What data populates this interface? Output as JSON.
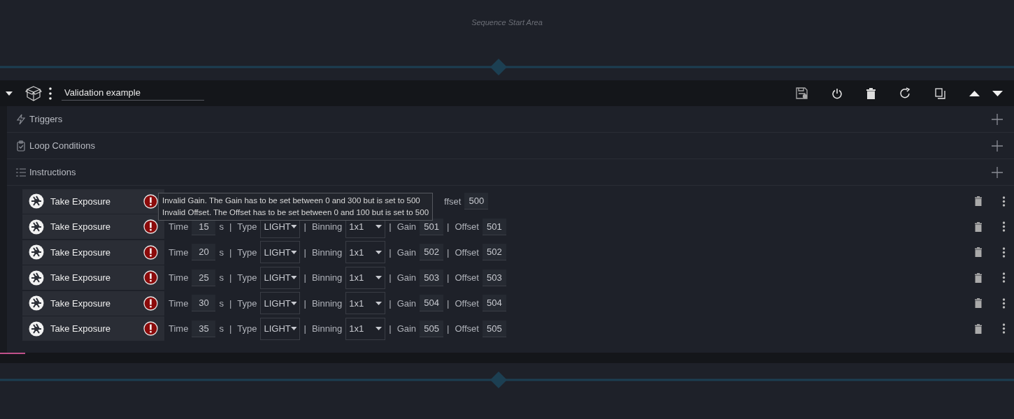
{
  "start_area": {
    "label": "Sequence Start Area"
  },
  "container": {
    "expanded": true,
    "name": "Validation example"
  },
  "sections": [
    {
      "kind": "triggers",
      "label": "Triggers"
    },
    {
      "kind": "conditions",
      "label": "Loop Conditions"
    },
    {
      "kind": "instructions",
      "label": "Instructions"
    }
  ],
  "tooltip": [
    "Invalid Gain. The Gain has to be set between 0 and 300 but is set to 500",
    "Invalid Offset. The Offset has to be set between 0 and 100 but is set to 500"
  ],
  "instructions": [
    {
      "name": "Take Exposure",
      "error": true,
      "params": [
        {
          "kind": "gap"
        },
        {
          "kind": "label",
          "text": "ffset"
        },
        {
          "kind": "field",
          "text": "500"
        }
      ]
    },
    {
      "name": "Take Exposure",
      "error": true,
      "params": [
        {
          "kind": "label",
          "text": "Time"
        },
        {
          "kind": "field",
          "text": "15"
        },
        {
          "kind": "label",
          "text": "s"
        },
        {
          "kind": "sep",
          "text": "|"
        },
        {
          "kind": "label",
          "text": "Type"
        },
        {
          "kind": "select",
          "text": "LIGHT"
        },
        {
          "kind": "sep",
          "text": "|"
        },
        {
          "kind": "label",
          "text": "Binning"
        },
        {
          "kind": "select",
          "text": "1x1"
        },
        {
          "kind": "sep",
          "text": "|"
        },
        {
          "kind": "label",
          "text": "Gain"
        },
        {
          "kind": "field",
          "text": "501"
        },
        {
          "kind": "sep",
          "text": "|"
        },
        {
          "kind": "label",
          "text": "Offset"
        },
        {
          "kind": "field",
          "text": "501"
        }
      ]
    },
    {
      "name": "Take Exposure",
      "error": true,
      "params": [
        {
          "kind": "label",
          "text": "Time"
        },
        {
          "kind": "field",
          "text": "20"
        },
        {
          "kind": "label",
          "text": "s"
        },
        {
          "kind": "sep",
          "text": "|"
        },
        {
          "kind": "label",
          "text": "Type"
        },
        {
          "kind": "select",
          "text": "LIGHT"
        },
        {
          "kind": "sep",
          "text": "|"
        },
        {
          "kind": "label",
          "text": "Binning"
        },
        {
          "kind": "select",
          "text": "1x1"
        },
        {
          "kind": "sep",
          "text": "|"
        },
        {
          "kind": "label",
          "text": "Gain"
        },
        {
          "kind": "field",
          "text": "502"
        },
        {
          "kind": "sep",
          "text": "|"
        },
        {
          "kind": "label",
          "text": "Offset"
        },
        {
          "kind": "field",
          "text": "502"
        }
      ]
    },
    {
      "name": "Take Exposure",
      "error": true,
      "params": [
        {
          "kind": "label",
          "text": "Time"
        },
        {
          "kind": "field",
          "text": "25"
        },
        {
          "kind": "label",
          "text": "s"
        },
        {
          "kind": "sep",
          "text": "|"
        },
        {
          "kind": "label",
          "text": "Type"
        },
        {
          "kind": "select",
          "text": "LIGHT"
        },
        {
          "kind": "sep",
          "text": "|"
        },
        {
          "kind": "label",
          "text": "Binning"
        },
        {
          "kind": "select",
          "text": "1x1"
        },
        {
          "kind": "sep",
          "text": "|"
        },
        {
          "kind": "label",
          "text": "Gain"
        },
        {
          "kind": "field",
          "text": "503"
        },
        {
          "kind": "sep",
          "text": "|"
        },
        {
          "kind": "label",
          "text": "Offset"
        },
        {
          "kind": "field",
          "text": "503"
        }
      ]
    },
    {
      "name": "Take Exposure",
      "error": true,
      "params": [
        {
          "kind": "label",
          "text": "Time"
        },
        {
          "kind": "field",
          "text": "30"
        },
        {
          "kind": "label",
          "text": "s"
        },
        {
          "kind": "sep",
          "text": "|"
        },
        {
          "kind": "label",
          "text": "Type"
        },
        {
          "kind": "select",
          "text": "LIGHT"
        },
        {
          "kind": "sep",
          "text": "|"
        },
        {
          "kind": "label",
          "text": "Binning"
        },
        {
          "kind": "select",
          "text": "1x1"
        },
        {
          "kind": "sep",
          "text": "|"
        },
        {
          "kind": "label",
          "text": "Gain"
        },
        {
          "kind": "field",
          "text": "504"
        },
        {
          "kind": "sep",
          "text": "|"
        },
        {
          "kind": "label",
          "text": "Offset"
        },
        {
          "kind": "field",
          "text": "504"
        }
      ]
    },
    {
      "name": "Take Exposure",
      "error": true,
      "params": [
        {
          "kind": "label",
          "text": "Time"
        },
        {
          "kind": "field",
          "text": "35"
        },
        {
          "kind": "label",
          "text": "s"
        },
        {
          "kind": "sep",
          "text": "|"
        },
        {
          "kind": "label",
          "text": "Type"
        },
        {
          "kind": "select",
          "text": "LIGHT"
        },
        {
          "kind": "sep",
          "text": "|"
        },
        {
          "kind": "label",
          "text": "Binning"
        },
        {
          "kind": "select",
          "text": "1x1"
        },
        {
          "kind": "sep",
          "text": "|"
        },
        {
          "kind": "label",
          "text": "Gain"
        },
        {
          "kind": "field",
          "text": "505"
        },
        {
          "kind": "sep",
          "text": "|"
        },
        {
          "kind": "label",
          "text": "Offset"
        },
        {
          "kind": "field",
          "text": "505"
        }
      ]
    }
  ]
}
